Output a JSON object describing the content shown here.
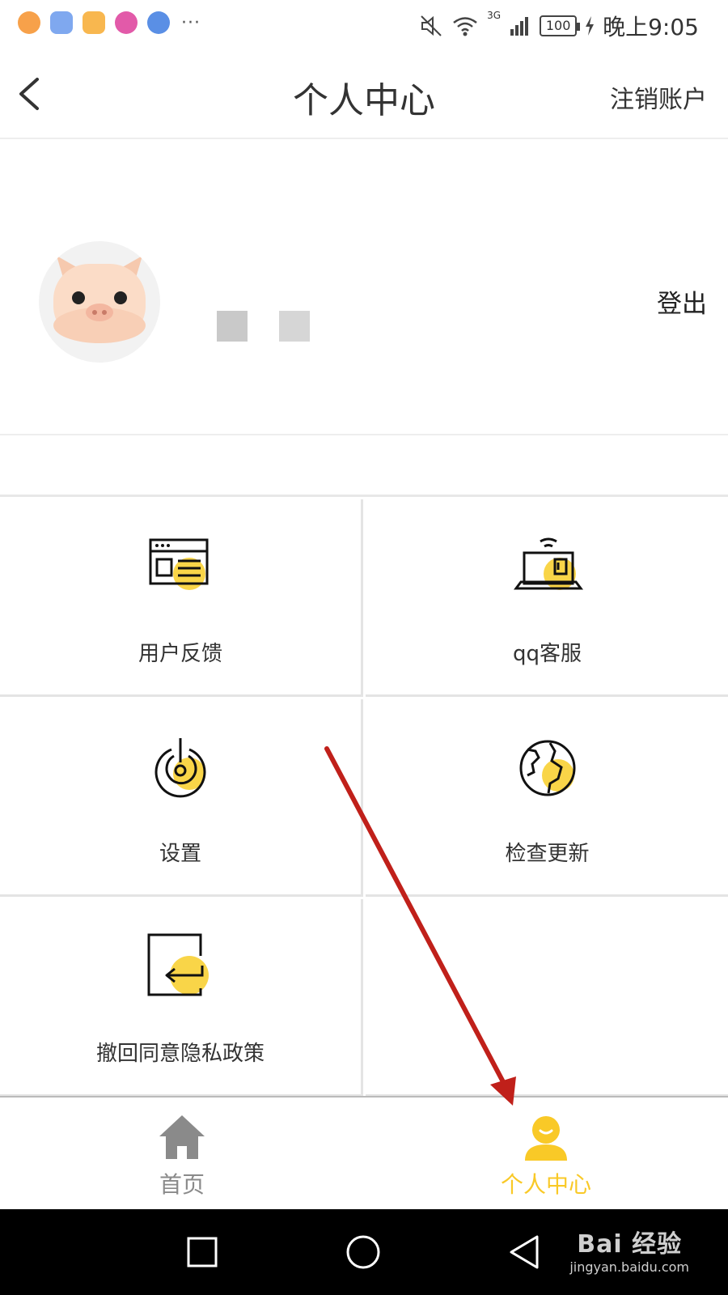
{
  "status_bar": {
    "battery": "100",
    "network": "3G",
    "time": "晚上9:05",
    "more": "···"
  },
  "header": {
    "title": "个人中心",
    "right_action": "注销账户"
  },
  "profile": {
    "logout_label": "登出"
  },
  "menu": {
    "items": [
      {
        "label": "用户反馈",
        "icon": "feedback-icon"
      },
      {
        "label": "qq客服",
        "icon": "customer-service-icon"
      },
      {
        "label": "设置",
        "icon": "settings-icon"
      },
      {
        "label": "检查更新",
        "icon": "update-globe-icon"
      },
      {
        "label": "撤回同意隐私政策",
        "icon": "revoke-privacy-icon"
      }
    ]
  },
  "bottom_nav": {
    "items": [
      {
        "label": "首页",
        "icon": "home-icon",
        "active": false
      },
      {
        "label": "个人中心",
        "icon": "profile-icon",
        "active": true
      }
    ]
  },
  "watermark": {
    "brand": "Bai  经验",
    "url": "jingyan.baidu.com"
  },
  "colors": {
    "accent": "#f9c927",
    "annotation_arrow": "#c0201a",
    "inactive": "#8a8a8a"
  }
}
